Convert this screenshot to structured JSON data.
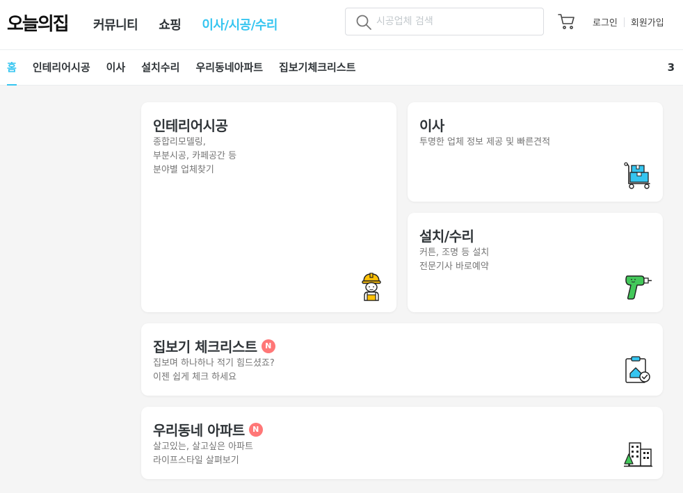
{
  "header": {
    "logo": "오늘의집",
    "nav": [
      {
        "label": "커뮤니티",
        "active": false
      },
      {
        "label": "쇼핑",
        "active": false
      },
      {
        "label": "이사/시공/수리",
        "active": true
      }
    ],
    "search": {
      "placeholder": "시공업체 검색",
      "value": ""
    },
    "login": "로그인",
    "signup": "회원가입"
  },
  "subnav": {
    "items": [
      {
        "label": "홈",
        "active": true
      },
      {
        "label": "인테리어시공",
        "active": false
      },
      {
        "label": "이사",
        "active": false
      },
      {
        "label": "설치수리",
        "active": false
      },
      {
        "label": "우리동네아파트",
        "active": false
      },
      {
        "label": "집보기체크리스트",
        "active": false
      }
    ],
    "more": "3"
  },
  "cards": {
    "interior": {
      "title": "인테리어시공",
      "desc": [
        "종합리모델링,",
        "부분시공, 카페공간 등",
        "분야별 업체찾기"
      ],
      "icon": "worker-icon"
    },
    "moving": {
      "title": "이사",
      "desc": [
        "투명한 업체 정보 제공 및 빠른견적"
      ],
      "icon": "moving-cart-icon"
    },
    "repair": {
      "title": "설치/수리",
      "desc": [
        "커튼, 조명 등 설치",
        "전문기사 바로예약"
      ],
      "icon": "drill-icon"
    },
    "checklist": {
      "title": "집보기 체크리스트",
      "badge": "N",
      "desc": [
        "집보며 하나하나 적기 힘드셨죠?",
        "이젠 쉽게 체크 하세요"
      ],
      "icon": "clipboard-check-icon"
    },
    "apartment": {
      "title": "우리동네 아파트",
      "badge": "N",
      "desc": [
        "살고있는, 살고싶은 아파트",
        "라이프스타일 살펴보기"
      ],
      "icon": "apartment-icon"
    }
  },
  "colors": {
    "accent": "#35c5f0",
    "badge": "#ff7777",
    "background": "#f5f5f5"
  }
}
